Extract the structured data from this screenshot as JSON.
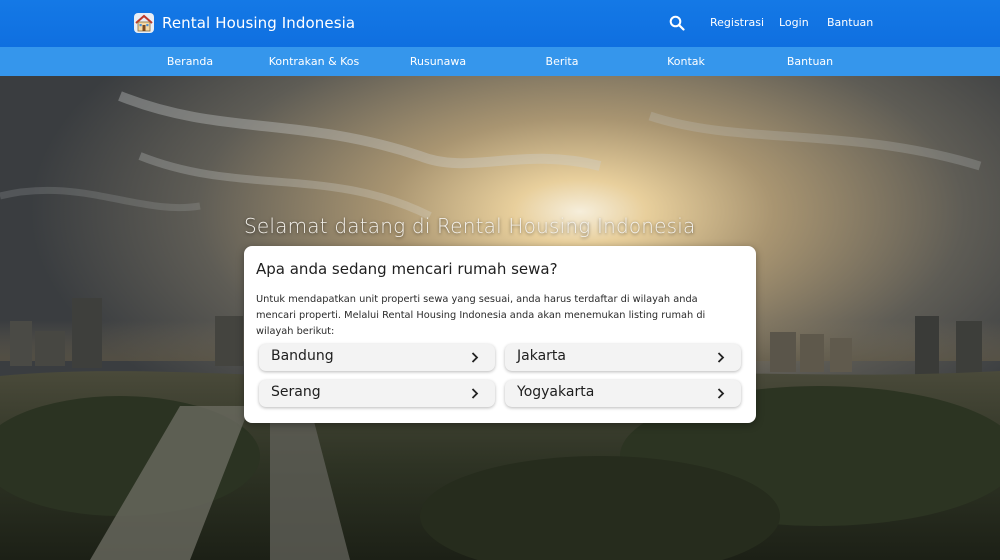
{
  "header": {
    "brand_name": "Rental Housing Indonesia",
    "brand_icon": "house-icon",
    "links": [
      "Registrasi",
      "Login",
      "Bantuan"
    ]
  },
  "nav": {
    "items": [
      "Beranda",
      "Kontrakan & Kos",
      "Rusunawa",
      "Berita",
      "Kontak",
      "Bantuan"
    ]
  },
  "hero": {
    "title": "Selamat datang di Rental Housing Indonesia"
  },
  "card": {
    "heading": "Apa anda sedang mencari rumah sewa?",
    "description": "Untuk mendapatkan unit properti sewa yang sesuai, anda harus terdaftar di wilayah anda mencari properti. Melalui Rental Housing Indonesia anda akan menemukan listing rumah di wilayah berikut:",
    "cities": [
      "Bandung",
      "Jakarta",
      "Serang",
      "Yogyakarta"
    ]
  },
  "colors": {
    "header_bg": "#1479e6",
    "nav_bg": "#3596ec",
    "card_bg": "#ffffff",
    "button_bg": "#f3f3f3"
  }
}
